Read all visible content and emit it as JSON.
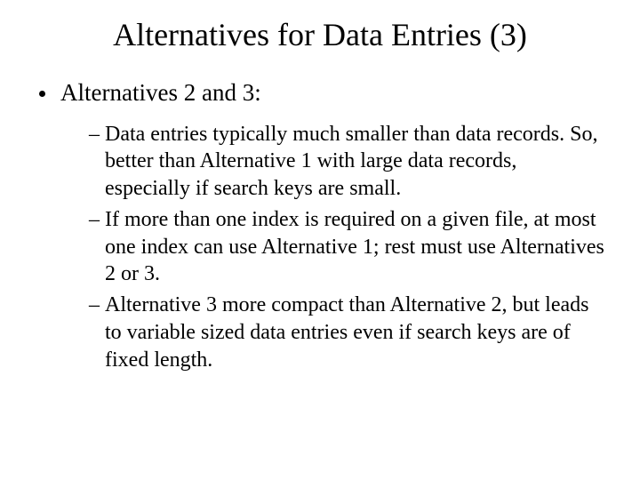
{
  "title": "Alternatives for Data Entries (3)",
  "bullet1": "Alternatives 2 and 3:",
  "sub1": "Data entries typically much smaller than data records.  So, better than Alternative 1 with large data records, especially if search keys are small.",
  "sub2": "If more than one index is required on a given file, at most one index can use Alternative 1; rest must use Alternatives 2 or 3.",
  "sub3": "Alternative 3 more compact than Alternative 2, but leads to variable sized data entries even if search keys are of fixed length."
}
